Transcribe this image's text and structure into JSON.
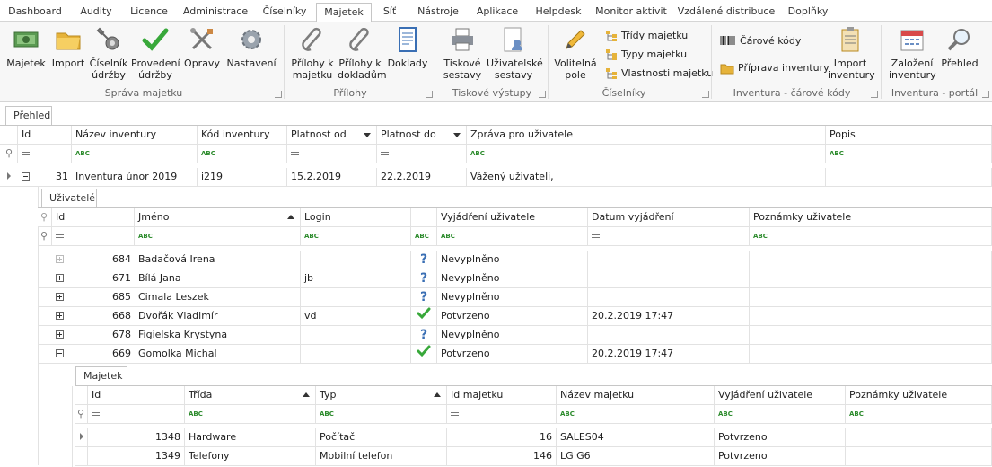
{
  "menu": [
    "Dashboard",
    "Audity",
    "Licence",
    "Administrace",
    "Číselníky",
    "Majetek",
    "Síť",
    "Nástroje",
    "Aplikace",
    "Helpdesk",
    "Monitor aktivit",
    "Vzdálené distribuce",
    "Doplňky"
  ],
  "ribbon": {
    "sprava": {
      "majetek": "Majetek",
      "import": "Import",
      "ciselnik1": "Číselník",
      "ciselnik2": "údržby",
      "provedeni1": "Provedení",
      "provedeni2": "údržby",
      "opravy": "Opravy",
      "nastaveni": "Nastavení",
      "group": "Správa majetku"
    },
    "prilohy": {
      "pm1": "Přílohy k",
      "pm2": "majetku",
      "pd1": "Přílohy k",
      "pd2": "dokladům",
      "doklady": "Doklady",
      "group": "Přílohy"
    },
    "tisk": {
      "t1": "Tiskové",
      "t2": "sestavy",
      "u1": "Uživatelské",
      "u2": "sestavy",
      "group": "Tiskové výstupy"
    },
    "ciselniky": {
      "v1": "Volitelná",
      "v2": "pole",
      "tridy": "Třídy majetku",
      "typy": "Typy majetku",
      "vlast": "Vlastnosti majetku",
      "group": "Číselníky"
    },
    "inventura": {
      "carove": "Čárové kódy",
      "priprava": "Příprava inventury",
      "imp1": "Import",
      "imp2": "inventury",
      "group": "Inventura - čárové kódy"
    },
    "portal": {
      "z1": "Založení",
      "z2": "inventury",
      "prehled": "Přehled",
      "group": "Inventura - portál"
    }
  },
  "tab_overview": "Přehled",
  "main_grid": {
    "headers": [
      "Id",
      "Název inventury",
      "Kód inventury",
      "Platnost od",
      "Platnost do",
      "Zpráva pro uživatele",
      "Popis"
    ],
    "row": {
      "id": "31",
      "name": "Inventura únor 2019",
      "code": "i219",
      "from": "15.2.2019",
      "to": "22.2.2019",
      "message": "Vážený uživateli,",
      "popis": ""
    }
  },
  "users": {
    "tab": "Uživatelé",
    "headers": [
      "Id",
      "Jméno",
      "Login",
      "",
      "Vyjádření uživatele",
      "Datum vyjádření",
      "Poznámky uživatele"
    ],
    "rows": [
      {
        "id": "684",
        "name": "Badačová Irena",
        "login": "",
        "status": "q",
        "statement": "Nevyplněno",
        "date": "",
        "note": ""
      },
      {
        "id": "671",
        "name": "Bílá Jana",
        "login": "jb",
        "status": "q",
        "statement": "Nevyplněno",
        "date": "",
        "note": ""
      },
      {
        "id": "685",
        "name": "Cimala Leszek",
        "login": "",
        "status": "q",
        "statement": "Nevyplněno",
        "date": "",
        "note": ""
      },
      {
        "id": "668",
        "name": "Dvořák Vladimír",
        "login": "vd",
        "status": "ok",
        "statement": "Potvrzeno",
        "date": "20.2.2019 17:47",
        "note": ""
      },
      {
        "id": "678",
        "name": "Figielska Krystyna",
        "login": "",
        "status": "q",
        "statement": "Nevyplněno",
        "date": "",
        "note": ""
      },
      {
        "id": "669",
        "name": "Gomolka Michal",
        "login": "",
        "status": "ok",
        "statement": "Potvrzeno",
        "date": "20.2.2019 17:47",
        "note": ""
      }
    ]
  },
  "assets": {
    "tab": "Majetek",
    "headers": [
      "Id",
      "Třída",
      "Typ",
      "Id majetku",
      "Název majetku",
      "Vyjádření uživatele",
      "Poznámky uživatele"
    ],
    "rows": [
      {
        "id": "1348",
        "trida": "Hardware",
        "typ": "Počítač",
        "idm": "16",
        "name": "SALES04",
        "statement": "Potvrzeno"
      },
      {
        "id": "1349",
        "trida": "Telefony",
        "typ": "Mobilní telefon",
        "idm": "146",
        "name": "LG G6",
        "statement": "Potvrzeno"
      }
    ]
  },
  "filter_abc": "ABC",
  "colors": {
    "accent": "#2f7bd3",
    "check": "#38a83a",
    "question": "#3a6fb4"
  }
}
